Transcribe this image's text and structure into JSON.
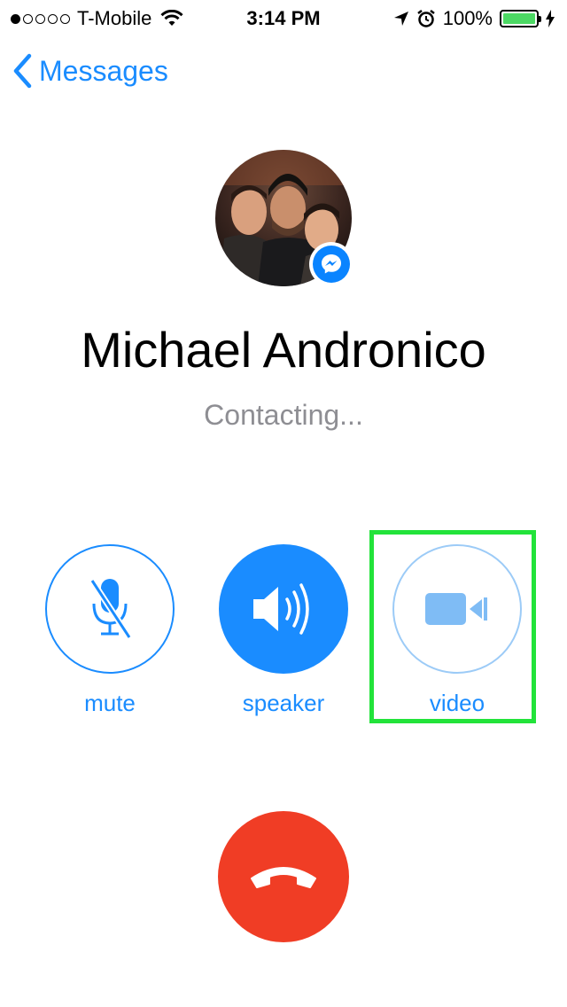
{
  "status_bar": {
    "carrier": "T-Mobile",
    "time": "3:14 PM",
    "battery": "100%",
    "signal_bars_filled": 1,
    "signal_bars_total": 5,
    "icons": [
      "wifi-icon",
      "location-arrow-icon",
      "alarm-icon",
      "battery-icon",
      "charging-bolt-icon"
    ]
  },
  "nav": {
    "back_label": "Messages"
  },
  "caller": {
    "name": "Michael Andronico",
    "status": "Contacting..."
  },
  "controls": [
    {
      "id": "mute",
      "label": "mute",
      "icon": "muted-microphone-icon"
    },
    {
      "id": "speaker",
      "label": "speaker",
      "icon": "speaker-icon"
    },
    {
      "id": "video",
      "label": "video",
      "icon": "video-camera-icon"
    }
  ],
  "end_call": {
    "icon": "hang-up-phone-icon"
  },
  "colors": {
    "accent": "#1a8cff",
    "end_call": "#f03d25",
    "highlight": "#22e33a",
    "battery": "#4cd964",
    "status_gray": "#8e8e93"
  }
}
